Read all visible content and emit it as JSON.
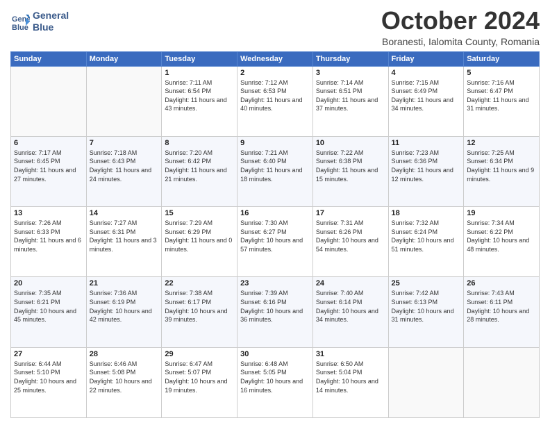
{
  "logo": {
    "line1": "General",
    "line2": "Blue"
  },
  "header": {
    "month": "October 2024",
    "location": "Boranesti, Ialomita County, Romania"
  },
  "weekdays": [
    "Sunday",
    "Monday",
    "Tuesday",
    "Wednesday",
    "Thursday",
    "Friday",
    "Saturday"
  ],
  "days": [
    {
      "num": "",
      "info": ""
    },
    {
      "num": "",
      "info": ""
    },
    {
      "num": "1",
      "info": "Sunrise: 7:11 AM\nSunset: 6:54 PM\nDaylight: 11 hours and 43 minutes."
    },
    {
      "num": "2",
      "info": "Sunrise: 7:12 AM\nSunset: 6:53 PM\nDaylight: 11 hours and 40 minutes."
    },
    {
      "num": "3",
      "info": "Sunrise: 7:14 AM\nSunset: 6:51 PM\nDaylight: 11 hours and 37 minutes."
    },
    {
      "num": "4",
      "info": "Sunrise: 7:15 AM\nSunset: 6:49 PM\nDaylight: 11 hours and 34 minutes."
    },
    {
      "num": "5",
      "info": "Sunrise: 7:16 AM\nSunset: 6:47 PM\nDaylight: 11 hours and 31 minutes."
    },
    {
      "num": "6",
      "info": "Sunrise: 7:17 AM\nSunset: 6:45 PM\nDaylight: 11 hours and 27 minutes."
    },
    {
      "num": "7",
      "info": "Sunrise: 7:18 AM\nSunset: 6:43 PM\nDaylight: 11 hours and 24 minutes."
    },
    {
      "num": "8",
      "info": "Sunrise: 7:20 AM\nSunset: 6:42 PM\nDaylight: 11 hours and 21 minutes."
    },
    {
      "num": "9",
      "info": "Sunrise: 7:21 AM\nSunset: 6:40 PM\nDaylight: 11 hours and 18 minutes."
    },
    {
      "num": "10",
      "info": "Sunrise: 7:22 AM\nSunset: 6:38 PM\nDaylight: 11 hours and 15 minutes."
    },
    {
      "num": "11",
      "info": "Sunrise: 7:23 AM\nSunset: 6:36 PM\nDaylight: 11 hours and 12 minutes."
    },
    {
      "num": "12",
      "info": "Sunrise: 7:25 AM\nSunset: 6:34 PM\nDaylight: 11 hours and 9 minutes."
    },
    {
      "num": "13",
      "info": "Sunrise: 7:26 AM\nSunset: 6:33 PM\nDaylight: 11 hours and 6 minutes."
    },
    {
      "num": "14",
      "info": "Sunrise: 7:27 AM\nSunset: 6:31 PM\nDaylight: 11 hours and 3 minutes."
    },
    {
      "num": "15",
      "info": "Sunrise: 7:29 AM\nSunset: 6:29 PM\nDaylight: 11 hours and 0 minutes."
    },
    {
      "num": "16",
      "info": "Sunrise: 7:30 AM\nSunset: 6:27 PM\nDaylight: 10 hours and 57 minutes."
    },
    {
      "num": "17",
      "info": "Sunrise: 7:31 AM\nSunset: 6:26 PM\nDaylight: 10 hours and 54 minutes."
    },
    {
      "num": "18",
      "info": "Sunrise: 7:32 AM\nSunset: 6:24 PM\nDaylight: 10 hours and 51 minutes."
    },
    {
      "num": "19",
      "info": "Sunrise: 7:34 AM\nSunset: 6:22 PM\nDaylight: 10 hours and 48 minutes."
    },
    {
      "num": "20",
      "info": "Sunrise: 7:35 AM\nSunset: 6:21 PM\nDaylight: 10 hours and 45 minutes."
    },
    {
      "num": "21",
      "info": "Sunrise: 7:36 AM\nSunset: 6:19 PM\nDaylight: 10 hours and 42 minutes."
    },
    {
      "num": "22",
      "info": "Sunrise: 7:38 AM\nSunset: 6:17 PM\nDaylight: 10 hours and 39 minutes."
    },
    {
      "num": "23",
      "info": "Sunrise: 7:39 AM\nSunset: 6:16 PM\nDaylight: 10 hours and 36 minutes."
    },
    {
      "num": "24",
      "info": "Sunrise: 7:40 AM\nSunset: 6:14 PM\nDaylight: 10 hours and 34 minutes."
    },
    {
      "num": "25",
      "info": "Sunrise: 7:42 AM\nSunset: 6:13 PM\nDaylight: 10 hours and 31 minutes."
    },
    {
      "num": "26",
      "info": "Sunrise: 7:43 AM\nSunset: 6:11 PM\nDaylight: 10 hours and 28 minutes."
    },
    {
      "num": "27",
      "info": "Sunrise: 6:44 AM\nSunset: 5:10 PM\nDaylight: 10 hours and 25 minutes."
    },
    {
      "num": "28",
      "info": "Sunrise: 6:46 AM\nSunset: 5:08 PM\nDaylight: 10 hours and 22 minutes."
    },
    {
      "num": "29",
      "info": "Sunrise: 6:47 AM\nSunset: 5:07 PM\nDaylight: 10 hours and 19 minutes."
    },
    {
      "num": "30",
      "info": "Sunrise: 6:48 AM\nSunset: 5:05 PM\nDaylight: 10 hours and 16 minutes."
    },
    {
      "num": "31",
      "info": "Sunrise: 6:50 AM\nSunset: 5:04 PM\nDaylight: 10 hours and 14 minutes."
    },
    {
      "num": "",
      "info": ""
    },
    {
      "num": "",
      "info": ""
    }
  ]
}
